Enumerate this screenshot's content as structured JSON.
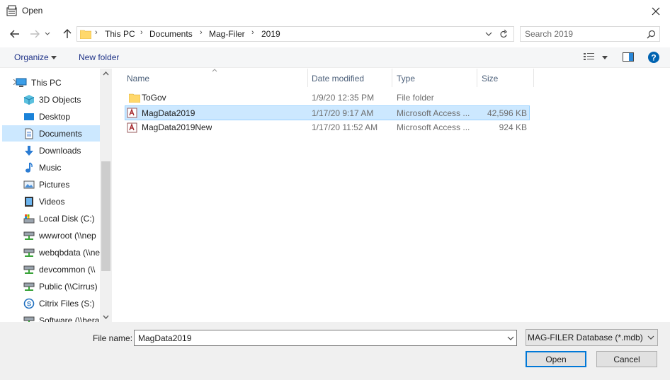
{
  "window": {
    "title": "Open"
  },
  "address": {
    "crumbs": [
      "This PC",
      "Documents",
      "Mag-Filer",
      "2019"
    ],
    "search_placeholder": "Search 2019"
  },
  "toolbar": {
    "organize": "Organize",
    "new_folder": "New folder"
  },
  "nav": {
    "items": [
      {
        "label": "This PC",
        "icon": "pc-icon"
      },
      {
        "label": "3D Objects",
        "icon": "cube-icon"
      },
      {
        "label": "Desktop",
        "icon": "desktop-icon"
      },
      {
        "label": "Documents",
        "icon": "document-icon"
      },
      {
        "label": "Downloads",
        "icon": "download-icon"
      },
      {
        "label": "Music",
        "icon": "music-icon"
      },
      {
        "label": "Pictures",
        "icon": "picture-icon"
      },
      {
        "label": "Videos",
        "icon": "video-icon"
      },
      {
        "label": "Local Disk (C:)",
        "icon": "disk-icon"
      },
      {
        "label": "wwwroot (\\\\nep",
        "icon": "network-drive-icon"
      },
      {
        "label": "webqbdata (\\\\ne",
        "icon": "network-drive-icon"
      },
      {
        "label": "devcommon (\\\\",
        "icon": "network-drive-icon"
      },
      {
        "label": "Public (\\\\Cirrus)",
        "icon": "network-drive-icon"
      },
      {
        "label": "Citrix Files (S:)",
        "icon": "citrix-icon"
      },
      {
        "label": "Software (\\\\hera",
        "icon": "network-drive-icon"
      }
    ]
  },
  "columns": {
    "name": "Name",
    "date": "Date modified",
    "type": "Type",
    "size": "Size"
  },
  "files": [
    {
      "name": "ToGov",
      "date": "1/9/20 12:35 PM",
      "type": "File folder",
      "size": "",
      "icon": "folder-icon"
    },
    {
      "name": "MagData2019",
      "date": "1/17/20 9:17 AM",
      "type": "Microsoft Access ...",
      "size": "42,596 KB",
      "icon": "access-db-icon"
    },
    {
      "name": "MagData2019New",
      "date": "1/17/20 11:52 AM",
      "type": "Microsoft Access ...",
      "size": "924 KB",
      "icon": "access-db-icon"
    }
  ],
  "bottom": {
    "file_name_label": "File name:",
    "file_name_value": "MagData2019",
    "file_type": "MAG-FILER Database (*.mdb)",
    "open": "Open",
    "cancel": "Cancel"
  },
  "colors": {
    "selection": "#cce8ff",
    "accent": "#0078d7",
    "link": "#1e3287"
  }
}
